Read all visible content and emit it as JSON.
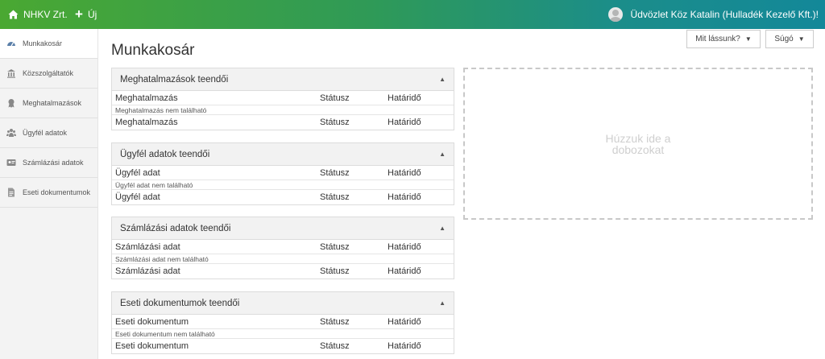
{
  "topbar": {
    "brand": "NHKV Zrt.",
    "new_label": "Új",
    "greeting": "Üdvözlet Köz Katalin (Hulladék Kezelő Kft.)!"
  },
  "sidebar": {
    "items": [
      {
        "label": "Munkakosár",
        "icon": "dashboard-icon"
      },
      {
        "label": "Közszolgáltatók",
        "icon": "building-icon"
      },
      {
        "label": "Meghatalmazások",
        "icon": "certificate-icon"
      },
      {
        "label": "Ügyfél adatok",
        "icon": "users-icon"
      },
      {
        "label": "Számlázási adatok",
        "icon": "invoice-icon"
      },
      {
        "label": "Eseti dokumentumok",
        "icon": "document-icon"
      }
    ]
  },
  "page": {
    "title": "Munkakosár",
    "view_button": "Mit lássunk?",
    "help_button": "Súgó"
  },
  "panels": [
    {
      "title": "Meghatalmazások teendői",
      "col1": "Meghatalmazás",
      "col2": "Státusz",
      "col3": "Határidő",
      "empty": "Meghatalmazás nem található"
    },
    {
      "title": "Ügyfél adatok teendői",
      "col1": "Ügyfél adat",
      "col2": "Státusz",
      "col3": "Határidő",
      "empty": "Ügyfél adat nem található"
    },
    {
      "title": "Számlázási adatok teendői",
      "col1": "Számlázási adat",
      "col2": "Státusz",
      "col3": "Határidő",
      "empty": "Számlázási adat nem található"
    },
    {
      "title": "Eseti dokumentumok teendői",
      "col1": "Eseti dokumentum",
      "col2": "Státusz",
      "col3": "Határidő",
      "empty": "Eseti dokumentum nem található"
    }
  ],
  "dropzone": {
    "line1": "Húzzuk ide a",
    "line2": "dobozokat"
  }
}
